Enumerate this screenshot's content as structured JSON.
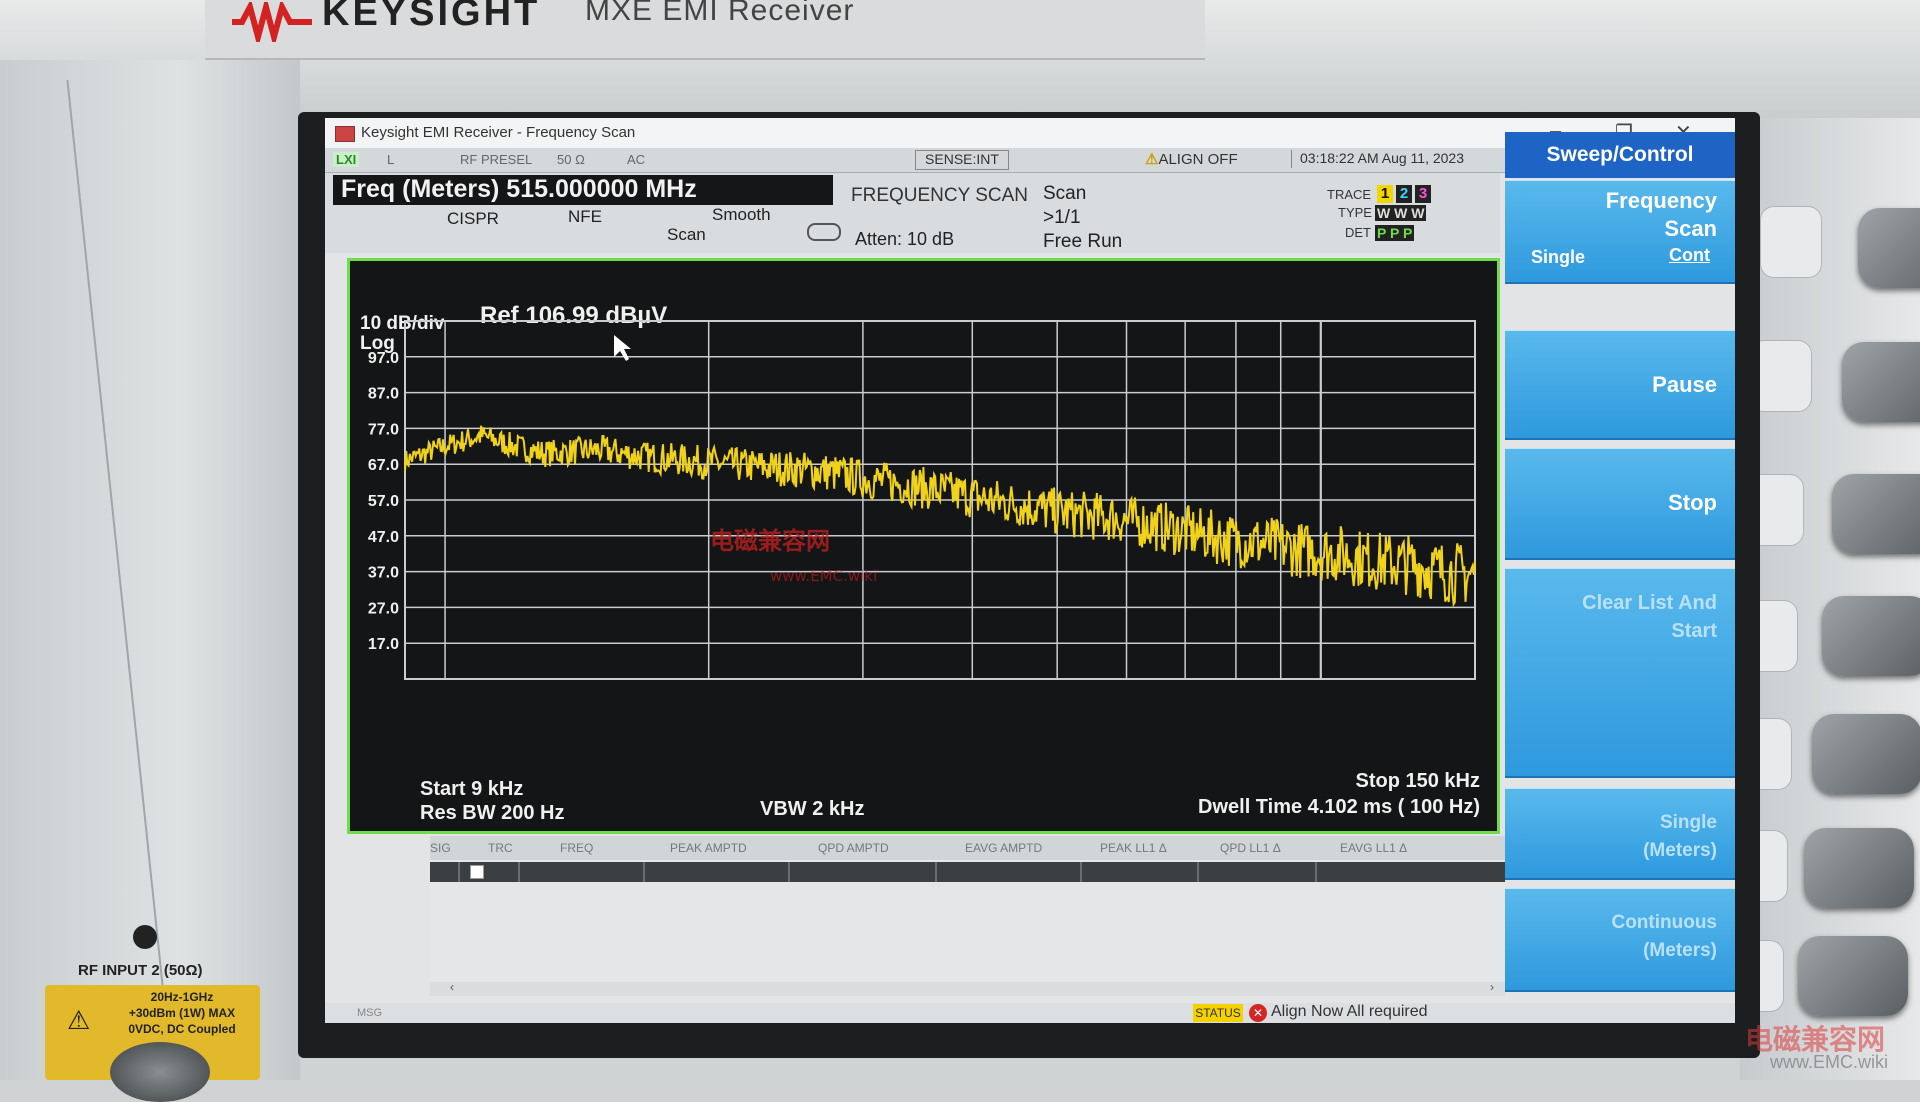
{
  "device": {
    "brand": "KEYSIGHT",
    "model": "MXE EMI Receiver",
    "rf_input_label": "RF INPUT 2  (50Ω)",
    "rf_input_warning": [
      "20Hz-1GHz",
      "+30dBm (1W) MAX",
      "0VDC, DC Coupled"
    ]
  },
  "window": {
    "title": "Keysight EMI Receiver - Frequency Scan",
    "min_icon": "–",
    "max_icon": "❐",
    "close_icon": "✕"
  },
  "status_row": {
    "lxi": "LXI",
    "l": "L",
    "rf_presel": "RF PRESEL",
    "impedance": "50 Ω",
    "coupling": "AC",
    "sense": "SENSE:INT",
    "align": "ALIGN OFF",
    "datetime": "03:18:22 AM Aug 11, 2023"
  },
  "info": {
    "freq": "Freq (Meters) 515.000000 MHz",
    "cispr": "CISPR",
    "nfe": "NFE",
    "smooth": "Smooth",
    "scan": "Scan",
    "mode": "FREQUENCY SCAN",
    "atten": "Atten: 10 dB",
    "scan_state": [
      "Scan",
      ">1/1",
      "Free Run"
    ],
    "trace_label": "TRACE",
    "type_label": "TYPE",
    "det_label": "DET",
    "traces": [
      {
        "num": "1",
        "color": "#f2d600"
      },
      {
        "num": "2",
        "color": "#38d8ff"
      },
      {
        "num": "3",
        "color": "#ff4fd8"
      }
    ],
    "types": "W W W",
    "dets": "P P P"
  },
  "plot": {
    "scale": "10 dB/div",
    "log": "Log",
    "ref": "Ref 106.99 dBµV",
    "start": "Start 9 kHz",
    "stop": "Stop 150 kHz",
    "rbw": "Res BW 200 Hz",
    "vbw": "VBW 2 kHz",
    "dwell": "Dwell Time 4.102 ms ( 100 Hz)",
    "trace_color": "#f0d21a",
    "grid_color": "#c9cdd0"
  },
  "chart_data": {
    "type": "line",
    "y_ticks": [
      "97.0",
      "87.0",
      "77.0",
      "67.0",
      "57.0",
      "47.0",
      "37.0",
      "27.0",
      "17.0"
    ],
    "ylim": [
      7,
      107
    ],
    "xlim": [
      9,
      150
    ],
    "x_scale": "log",
    "x_unit": "kHz",
    "y_unit": "dBµV",
    "grid": true,
    "series": [
      {
        "x": [
          9,
          10,
          11,
          12,
          13,
          15,
          17,
          19,
          21,
          24,
          27,
          30,
          34,
          38,
          42,
          47,
          52,
          58,
          64,
          71,
          78,
          86,
          95,
          105,
          115,
          126,
          138,
          150
        ],
        "y": [
          68,
          72,
          75,
          72,
          70,
          71,
          69,
          68,
          67,
          66,
          65,
          63,
          61,
          59,
          57,
          55,
          53,
          52,
          50,
          48,
          46,
          45,
          43,
          42,
          40,
          39,
          37,
          36
        ]
      }
    ]
  },
  "marker_table": {
    "columns": [
      "SIG",
      "TRC",
      "FREQ",
      "PEAK AMPTD",
      "QPD AMPTD",
      "EAVG AMPTD",
      "PEAK LL1 Δ",
      "QPD LL1 Δ",
      "EAVG LL1 Δ"
    ]
  },
  "msgbar": {
    "msg": "MSG",
    "status": "STATUS",
    "message": "Align Now All required"
  },
  "softkeys": {
    "title": "Sweep/Control",
    "frequency_scan": [
      "Frequency",
      "Scan"
    ],
    "single": "Single",
    "cont": "Cont",
    "pause": "Pause",
    "stop": "Stop",
    "clear": [
      "Clear List And",
      "Start"
    ],
    "single_meters": [
      "Single",
      "(Meters)"
    ],
    "continuous_meters": [
      "Continuous",
      "(Meters)"
    ]
  },
  "watermark": {
    "cn": "电磁兼容网",
    "url": "www.EMC.wiki"
  }
}
